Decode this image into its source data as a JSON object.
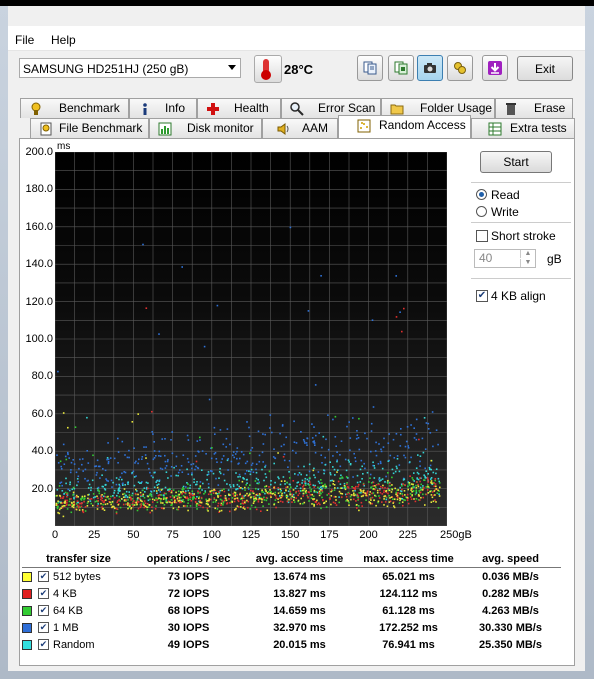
{
  "menu": {
    "file": "File",
    "help": "Help"
  },
  "toolbar": {
    "drive": "SAMSUNG HD251HJ (250 gB)",
    "temperature": "28°C",
    "exit_label": "Exit"
  },
  "tabs_row1": [
    {
      "label": "Benchmark",
      "icon": "medal-icon"
    },
    {
      "label": "Info",
      "icon": "info-icon"
    },
    {
      "label": "Health",
      "icon": "health-cross-icon"
    },
    {
      "label": "Error Scan",
      "icon": "magnifier-icon"
    },
    {
      "label": "Folder Usage",
      "icon": "folder-icon"
    },
    {
      "label": "Erase",
      "icon": "trash-icon"
    }
  ],
  "tabs_row2": [
    {
      "label": "File Benchmark",
      "icon": "file-medal-icon"
    },
    {
      "label": "Disk monitor",
      "icon": "chart-icon"
    },
    {
      "label": "AAM",
      "icon": "speaker-icon"
    },
    {
      "label": "Random Access",
      "icon": "random-grid-icon",
      "selected": true
    },
    {
      "label": "Extra tests",
      "icon": "table-icon"
    }
  ],
  "controls": {
    "start_label": "Start",
    "read_label": "Read",
    "write_label": "Write",
    "short_stroke_label": "Short stroke",
    "short_stroke_value": "40",
    "gb_label": "gB",
    "align_label": "4 KB align"
  },
  "chart_data": {
    "type": "scatter",
    "y_unit": "ms",
    "x_unit": "gB",
    "ylim": [
      0,
      200
    ],
    "xlim": [
      0,
      250
    ],
    "yticks": [
      "200.0",
      "180.0",
      "160.0",
      "140.0",
      "120.0",
      "100.0",
      "80.0",
      "60.0",
      "40.0",
      "20.0"
    ],
    "xticks": [
      "0",
      "25",
      "50",
      "75",
      "100",
      "125",
      "150",
      "175",
      "200",
      "225",
      "250gB"
    ],
    "grid": true,
    "series": [
      {
        "name": "512 bytes",
        "color": "#e8e83a",
        "avg": 13.674,
        "max": 65.021
      },
      {
        "name": "4 KB",
        "color": "#e03030",
        "avg": 13.827,
        "max": 124.112
      },
      {
        "name": "64 KB",
        "color": "#33cc33",
        "avg": 14.659,
        "max": 61.128
      },
      {
        "name": "1 MB",
        "color": "#2f72d8",
        "avg": 32.97,
        "max": 172.252
      },
      {
        "name": "Random",
        "color": "#35d5d5",
        "avg": 20.015,
        "max": 76.941
      }
    ]
  },
  "results": {
    "headers": [
      "transfer size",
      "operations / sec",
      "avg. access time",
      "max. access time",
      "avg. speed"
    ],
    "rows": [
      {
        "size": "512 bytes",
        "color": "#ffff33",
        "ops": "73 IOPS",
        "avg": "13.674 ms",
        "max": "65.021 ms",
        "speed": "0.036 MB/s"
      },
      {
        "size": "4 KB",
        "color": "#e02020",
        "ops": "72 IOPS",
        "avg": "13.827 ms",
        "max": "124.112 ms",
        "speed": "0.282 MB/s"
      },
      {
        "size": "64 KB",
        "color": "#33cc33",
        "ops": "68 IOPS",
        "avg": "14.659 ms",
        "max": "61.128 ms",
        "speed": "4.263 MB/s"
      },
      {
        "size": "1 MB",
        "color": "#2f6fd8",
        "ops": "30 IOPS",
        "avg": "32.970 ms",
        "max": "172.252 ms",
        "speed": "30.330 MB/s"
      },
      {
        "size": "Random",
        "color": "#33e0e0",
        "ops": "49 IOPS",
        "avg": "20.015 ms",
        "max": "76.941 ms",
        "speed": "25.350 MB/s"
      }
    ]
  }
}
